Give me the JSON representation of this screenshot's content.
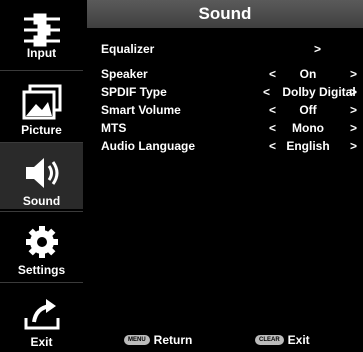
{
  "sidebar": {
    "items": [
      {
        "label": "Input",
        "icon": "input-cables-icon"
      },
      {
        "label": "Picture",
        "icon": "picture-icon"
      },
      {
        "label": "Sound",
        "icon": "speaker-icon"
      },
      {
        "label": "Settings",
        "icon": "gear-icon"
      },
      {
        "label": "Exit",
        "icon": "exit-icon"
      }
    ],
    "active": "Sound"
  },
  "panel": {
    "title": "Sound",
    "rows": [
      {
        "name": "Equalizer",
        "value": "",
        "right_arrow": ">"
      },
      {
        "name": "Speaker",
        "left_arrow": "<",
        "value": "On",
        "right_arrow": ">"
      },
      {
        "name": "SPDIF Type",
        "left_arrow": "<",
        "value": "Dolby Digital",
        "right_arrow": ">"
      },
      {
        "name": "Smart Volume",
        "left_arrow": "<",
        "value": "Off",
        "right_arrow": ">"
      },
      {
        "name": "MTS",
        "left_arrow": "<",
        "value": "Mono",
        "right_arrow": ">"
      },
      {
        "name": "Audio Language",
        "left_arrow": "<",
        "value": "English",
        "right_arrow": ">"
      }
    ]
  },
  "footer": {
    "menu_key": "MENU",
    "menu_label": "Return",
    "clear_key": "CLEAR",
    "clear_label": "Exit"
  },
  "colors": {
    "title_bar": "#4a4a4a",
    "background": "#000000",
    "active_item": "#2a2a2a"
  }
}
